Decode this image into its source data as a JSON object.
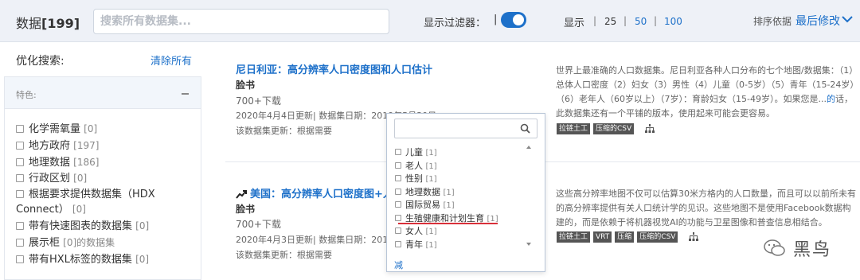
{
  "header": {
    "datasets_label": "数据",
    "datasets_count": "[199]",
    "search_placeholder": "搜索所有数据集...",
    "show_filters_label": "显示过滤器：",
    "show_filters_on": true,
    "show_label": "显示",
    "per_page": [
      "25",
      "50",
      "100"
    ],
    "per_page_active": "25",
    "sort_label": "排序依据",
    "sort_value": "最后修改"
  },
  "sidebar": {
    "title": "优化搜索:",
    "clear_all": "清除所有",
    "panel_title": "特色:",
    "facets": [
      {
        "label": "化学需氧量",
        "count": "[0]"
      },
      {
        "label": "地方政府",
        "count": "[197]"
      },
      {
        "label": "地理数据",
        "count": "[186]"
      },
      {
        "label": "行政区划",
        "count": "[0]"
      },
      {
        "label": "根据要求提供数据集（HDX Connect）",
        "count": "[0]"
      },
      {
        "label": "带有快速图表的数据集",
        "count": "[0]"
      },
      {
        "label": "展示柜",
        "count": "[0]的数据集"
      },
      {
        "label": "带有HXL标签的数据集",
        "count": "[0]"
      }
    ]
  },
  "results": [
    {
      "title": "尼日利亚：高分辨率人口密度图和人口估计",
      "org": "脸书",
      "downloads": "700+下载",
      "meta": "2020年4月4日更新| 数据集日期：2019年5月30日",
      "update_freq": "该数据集更新：根据需要",
      "desc_1": "世界上最准确的人口数据集。尼日利亚各种人口分布的七个地图/数据集：（1）总体人口密度（2）妇女（3）男性（4）儿童（0-5岁）（5）青年（15-24岁）（6）老年人（60岁以上）（7岁）：育龄妇女（15-49岁）。如果您是...",
      "desc_link": "的",
      "desc_2": "话，此数据集还有一个平铺的版本，使用起来可能会更容易。",
      "tags": [
        "拉链土工",
        "压缩的CSV"
      ]
    },
    {
      "title": "美国：高分辨率人口密度图+人口估计",
      "org": "脸书",
      "downloads": "700+下载",
      "meta": "2020年4月3日更新| 数据集日期：2019年",
      "update_freq": "该数据集更新：根据需要",
      "desc_1": "这些高分辨率地图不仅可以估算30米方格内的人口数量，而且可以以前所未有的高分辨率提供有关人口统计学的见识。这些地图不是使用Facebook数据构建的，而是依赖于将机器视觉AI的功能与卫星图像和普查信息相结合。",
      "tags": [
        "拉链土工",
        "VRT",
        "压缩",
        "压缩的CSV"
      ]
    }
  ],
  "popup": {
    "items": [
      {
        "label": "儿童",
        "count": "[1]"
      },
      {
        "label": "老人",
        "count": "[1]"
      },
      {
        "label": "性别",
        "count": "[1]"
      },
      {
        "label": "地理数据",
        "count": "[1]"
      },
      {
        "label": "国际贸易",
        "count": "[1]"
      },
      {
        "label": "生殖健康和计划生育",
        "count": "[1]"
      },
      {
        "label": "女人",
        "count": "[1]"
      },
      {
        "label": "青年",
        "count": "[1]"
      }
    ],
    "less_label": "减"
  },
  "watermark": "黑鸟",
  "colors": {
    "accent": "#1d70c9",
    "topbar": "#eef1f7",
    "highlight_underline": "#d9303a"
  }
}
